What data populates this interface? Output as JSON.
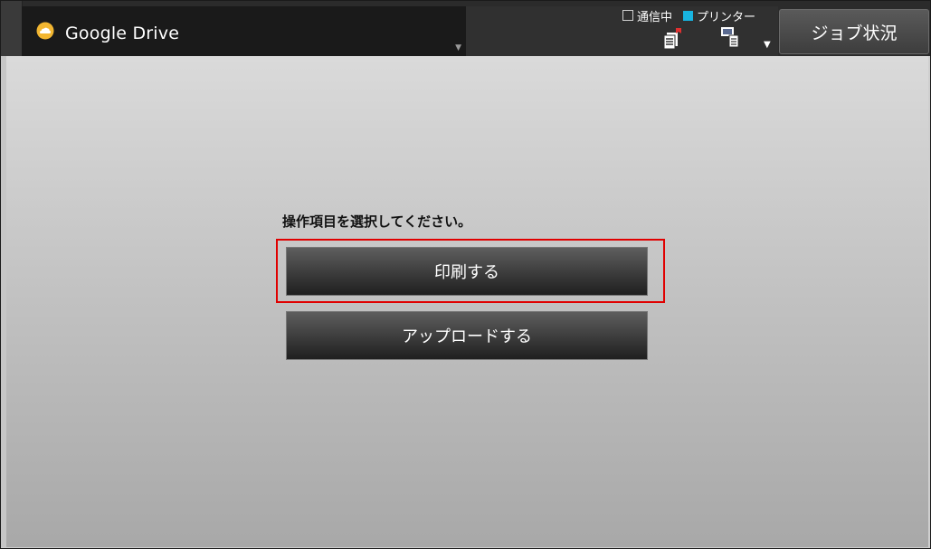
{
  "header": {
    "app_title": "Google Drive",
    "app_icon": "cloud-icon",
    "legend": {
      "communicating_label": "通信中",
      "printer_label": "プリンター"
    },
    "job_status_label": "ジョブ状況",
    "colors": {
      "bar_background": "#2b2b2b",
      "printer_indicator": "#18b4e0",
      "cloud_icon": "#f2b631"
    }
  },
  "main": {
    "prompt": "操作項目を選択してください。",
    "buttons": [
      {
        "label": "印刷する",
        "highlighted": true
      },
      {
        "label": "アップロードする",
        "highlighted": false
      }
    ],
    "highlight_color": "#e00000"
  }
}
